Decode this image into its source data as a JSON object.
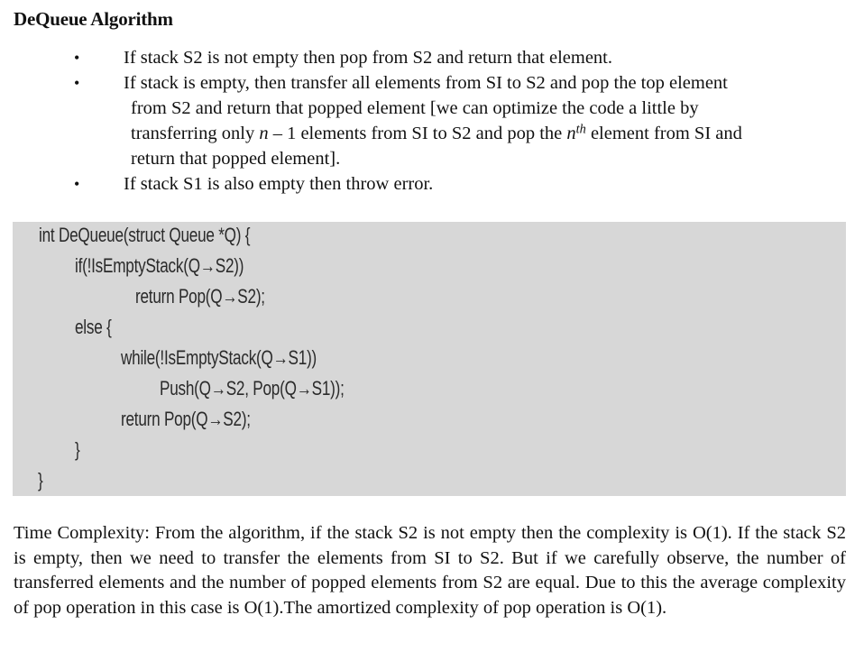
{
  "heading": "DeQueue Algorithm",
  "bullets": [
    {
      "first_line": "If stack S2 is not empty then pop from S2 and return that element.",
      "rest": []
    },
    {
      "first_line": "If stack is empty, then transfer all elements from SI to S2 and pop the top element",
      "rest": [
        "from S2 and return that popped element [we can optimize the code a little by",
        {
          "before_n": "transferring only ",
          "n": "n",
          "after_n": " – 1 elements from SI to S2 and pop the ",
          "nth_base": "n",
          "nth_sup": "th",
          "after_nth": " element from SI and"
        },
        "return that popped element]."
      ]
    },
    {
      "first_line": "If stack S1 is also empty then throw error.",
      "rest": []
    }
  ],
  "code_lines": [
    "int DeQueue(struct Queue *Q) {",
    "if(!IsEmptyStack(Q→S2))",
    "return Pop(Q→S2);",
    "else {",
    "while(!IsEmptyStack(Q→S1))",
    "Push(Q→S2, Pop(Q→S1));",
    "return Pop(Q→S2);",
    "}",
    "}"
  ],
  "paragraph": "Time Complexity: From the algorithm, if the stack S2 is not empty then the complexity is O(1). If the stack S2 is empty, then we need to transfer the elements from SI to S2. But if we carefully observe, the number of transferred elements and the number of popped elements from S2 are equal. Due to this the average complexity of pop operation in this case is O(1).The amortized complexity of pop operation is O(1).",
  "bullet_glyph": "•",
  "colors": {
    "code_background": "#d7d7d7",
    "text": "#111111"
  }
}
